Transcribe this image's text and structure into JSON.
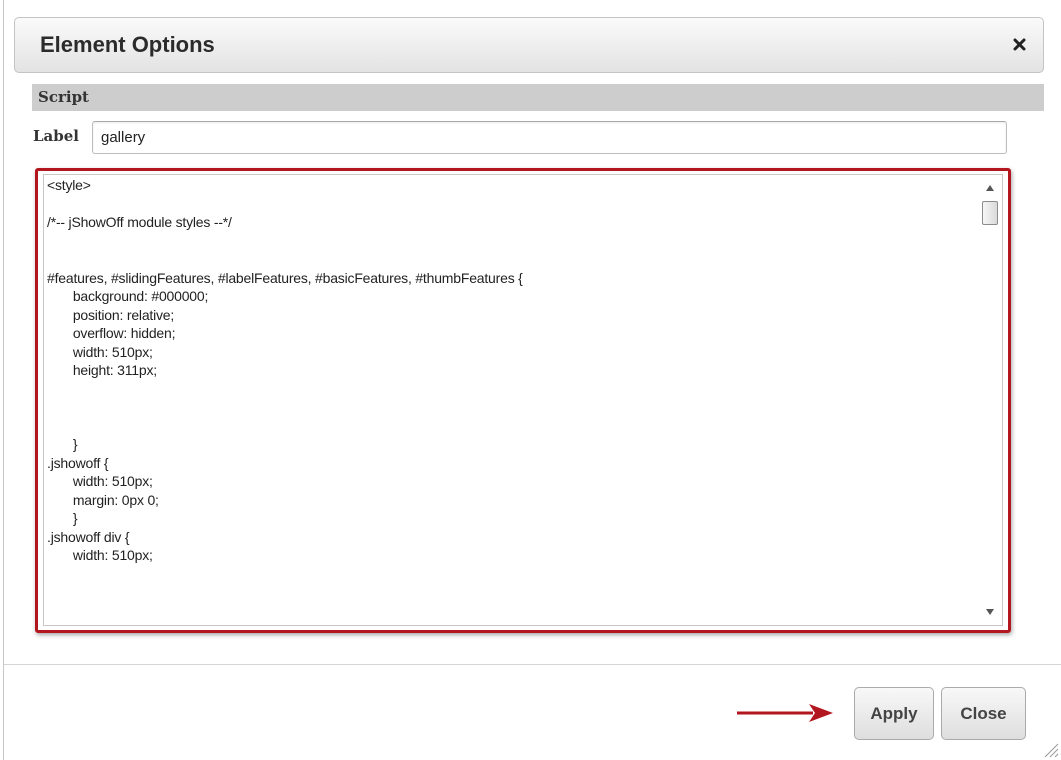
{
  "dialog": {
    "title": "Element Options",
    "close_icon": "close-x-icon"
  },
  "section": {
    "title": "Script"
  },
  "label_field": {
    "label": "Label",
    "value": "gallery"
  },
  "script_editor": {
    "content": "<style>\n\n/*-- jShowOff module styles --*/\n\n\n#features, #slidingFeatures, #labelFeatures, #basicFeatures, #thumbFeatures {\n       background: #000000;\n       position: relative;\n       overflow: hidden;\n       width: 510px;\n       height: 311px;\n\n\n\n       }\n.jshowoff {\n       width: 510px;\n       margin: 0px 0;\n       }\n.jshowoff div {\n       width: 510px;",
    "scroll_up_icon": "triangle-up-icon",
    "scroll_down_icon": "triangle-down-icon"
  },
  "buttons": {
    "apply": "Apply",
    "close": "Close"
  },
  "annotations": {
    "highlight_color": "#b2161e",
    "arrow_color": "#b2161e"
  }
}
